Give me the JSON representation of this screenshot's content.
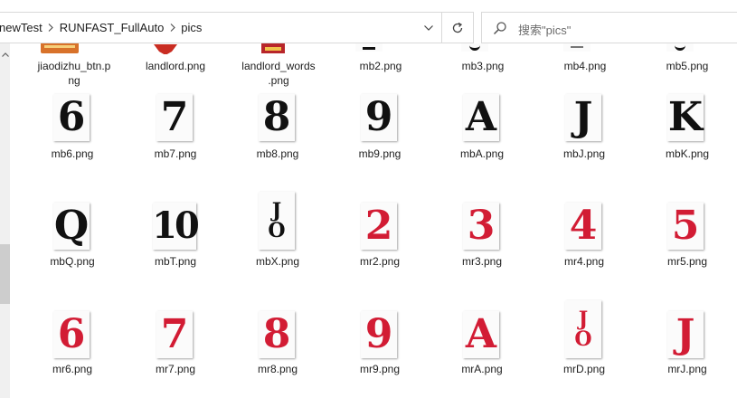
{
  "breadcrumb": [
    "newTest",
    "RUNFAST_FullAuto",
    "pics"
  ],
  "search": {
    "placeholder": "搜索\"pics\""
  },
  "top_row": [
    {
      "name": "jiaodizhu_btn.png",
      "line1": "jiaodizhu_btn.p",
      "line2": "ng"
    },
    {
      "name": "landlord.png",
      "line1": "landlord.png",
      "line2": ""
    },
    {
      "name": "landlord_words.png",
      "line1": "landlord_words",
      "line2": ".png"
    },
    {
      "name": "mb2.png",
      "line1": "mb2.png",
      "line2": ""
    },
    {
      "name": "mb3.png",
      "line1": "mb3.png",
      "line2": ""
    },
    {
      "name": "mb4.png",
      "line1": "mb4.png",
      "line2": ""
    },
    {
      "name": "mb5.png",
      "line1": "mb5.png",
      "line2": ""
    }
  ],
  "rows": [
    [
      {
        "name": "mb6.png",
        "glyph": "6",
        "color": "black"
      },
      {
        "name": "mb7.png",
        "glyph": "7",
        "color": "black"
      },
      {
        "name": "mb8.png",
        "glyph": "8",
        "color": "black"
      },
      {
        "name": "mb9.png",
        "glyph": "9",
        "color": "black"
      },
      {
        "name": "mbA.png",
        "glyph": "A",
        "color": "black"
      },
      {
        "name": "mbJ.png",
        "glyph": "J",
        "color": "black"
      },
      {
        "name": "mbK.png",
        "glyph": "K",
        "color": "black"
      }
    ],
    [
      {
        "name": "mbQ.png",
        "glyph": "Q",
        "color": "black"
      },
      {
        "name": "mbT.png",
        "glyph": "10",
        "color": "black"
      },
      {
        "name": "mbX.png",
        "glyph": "JO",
        "color": "black"
      },
      {
        "name": "mr2.png",
        "glyph": "2",
        "color": "red"
      },
      {
        "name": "mr3.png",
        "glyph": "3",
        "color": "red"
      },
      {
        "name": "mr4.png",
        "glyph": "4",
        "color": "red"
      },
      {
        "name": "mr5.png",
        "glyph": "5",
        "color": "red"
      }
    ],
    [
      {
        "name": "mr6.png",
        "glyph": "6",
        "color": "red"
      },
      {
        "name": "mr7.png",
        "glyph": "7",
        "color": "red"
      },
      {
        "name": "mr8.png",
        "glyph": "8",
        "color": "red"
      },
      {
        "name": "mr9.png",
        "glyph": "9",
        "color": "red"
      },
      {
        "name": "mrA.png",
        "glyph": "A",
        "color": "red"
      },
      {
        "name": "mrD.png",
        "glyph": "JO",
        "color": "red"
      },
      {
        "name": "mrJ.png",
        "glyph": "J",
        "color": "red"
      }
    ]
  ],
  "colors": {
    "black_card": "#111111",
    "red_card": "#d21c34",
    "accent": "#e5f3ff"
  }
}
